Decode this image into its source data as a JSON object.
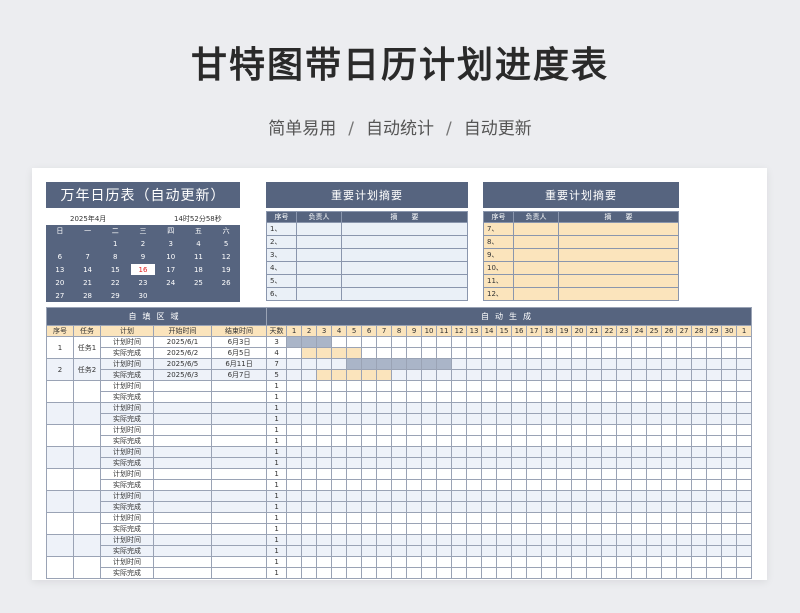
{
  "hero": {
    "title": "甘特图带日历计划进度表",
    "tags": [
      "简单易用",
      "自动统计",
      "自动更新"
    ],
    "separator": "/"
  },
  "calendar": {
    "title": "万年日历表（自动更新）",
    "date": "2025年4月",
    "time": "14时52分58秒",
    "weekdays": [
      "日",
      "一",
      "二",
      "三",
      "四",
      "五",
      "六"
    ],
    "rows": [
      [
        "",
        "",
        "1",
        "2",
        "3",
        "4",
        "5"
      ],
      [
        "6",
        "7",
        "8",
        "9",
        "10",
        "11",
        "12"
      ],
      [
        "13",
        "14",
        "15",
        "16",
        "17",
        "18",
        "19"
      ],
      [
        "20",
        "21",
        "22",
        "23",
        "24",
        "25",
        "26"
      ],
      [
        "27",
        "28",
        "29",
        "30",
        "",
        "",
        ""
      ]
    ],
    "today": "16",
    "today_color": "#e02020"
  },
  "summary_left": {
    "title": "重要计划摘要",
    "headers": [
      "序号",
      "负责人",
      "摘　　要"
    ],
    "rows": [
      "1、",
      "2、",
      "3、",
      "4、",
      "5、",
      "6、"
    ]
  },
  "summary_right": {
    "title": "重要计划摘要",
    "headers": [
      "序号",
      "负责人",
      "摘　　要"
    ],
    "rows": [
      "7、",
      "8、",
      "9、",
      "10、",
      "11、",
      "12、"
    ]
  },
  "gantt": {
    "manual_label": "自填区域",
    "auto_label": "自动生成",
    "headers": [
      "序号",
      "任务",
      "计划",
      "开始时间",
      "结束时间",
      "天数"
    ],
    "days": [
      "1",
      "2",
      "3",
      "4",
      "5",
      "6",
      "7",
      "8",
      "9",
      "10",
      "11",
      "12",
      "13",
      "14",
      "15",
      "16",
      "17",
      "18",
      "19",
      "20",
      "21",
      "22",
      "23",
      "24",
      "25",
      "26",
      "27",
      "28",
      "29",
      "30",
      "1"
    ],
    "plan_label": "计划时间",
    "actual_label": "实际完成",
    "tasks": [
      {
        "no": "1",
        "name": "任务1",
        "plan": {
          "start": "2025/6/1",
          "end": "6月3日",
          "days": "3",
          "bar_start_day": 1,
          "bar_days": 3
        },
        "actual": {
          "start": "2025/6/2",
          "end": "6月5日",
          "days": "4",
          "bar_start_day": 2,
          "bar_days": 4
        }
      },
      {
        "no": "2",
        "name": "任务2",
        "plan": {
          "start": "2025/6/5",
          "end": "6月11日",
          "days": "7",
          "bar_start_day": 5,
          "bar_days": 7
        },
        "actual": {
          "start": "2025/6/3",
          "end": "6月7日",
          "days": "5",
          "bar_start_day": 3,
          "bar_days": 5
        }
      },
      {
        "no": "",
        "name": "",
        "plan": {
          "start": "",
          "end": "",
          "days": "1"
        },
        "actual": {
          "start": "",
          "end": "",
          "days": "1"
        }
      },
      {
        "no": "",
        "name": "",
        "plan": {
          "start": "",
          "end": "",
          "days": "1"
        },
        "actual": {
          "start": "",
          "end": "",
          "days": "1"
        }
      },
      {
        "no": "",
        "name": "",
        "plan": {
          "start": "",
          "end": "",
          "days": "1"
        },
        "actual": {
          "start": "",
          "end": "",
          "days": "1"
        }
      },
      {
        "no": "",
        "name": "",
        "plan": {
          "start": "",
          "end": "",
          "days": "1"
        },
        "actual": {
          "start": "",
          "end": "",
          "days": "1"
        }
      },
      {
        "no": "",
        "name": "",
        "plan": {
          "start": "",
          "end": "",
          "days": "1"
        },
        "actual": {
          "start": "",
          "end": "",
          "days": "1"
        }
      },
      {
        "no": "",
        "name": "",
        "plan": {
          "start": "",
          "end": "",
          "days": "1"
        },
        "actual": {
          "start": "",
          "end": "",
          "days": "1"
        }
      },
      {
        "no": "",
        "name": "",
        "plan": {
          "start": "",
          "end": "",
          "days": "1"
        },
        "actual": {
          "start": "",
          "end": "",
          "days": "1"
        }
      },
      {
        "no": "",
        "name": "",
        "plan": {
          "start": "",
          "end": "",
          "days": "1"
        },
        "actual": {
          "start": "",
          "end": "",
          "days": "1"
        }
      },
      {
        "no": "",
        "name": "",
        "plan": {
          "start": "",
          "end": "",
          "days": "1"
        },
        "actual": {
          "start": "",
          "end": "",
          "days": "1"
        }
      }
    ],
    "colors": {
      "plan_bar": "#aab5c8",
      "actual_bar": "#fbe4bc",
      "header_navy": "#56647f"
    }
  }
}
